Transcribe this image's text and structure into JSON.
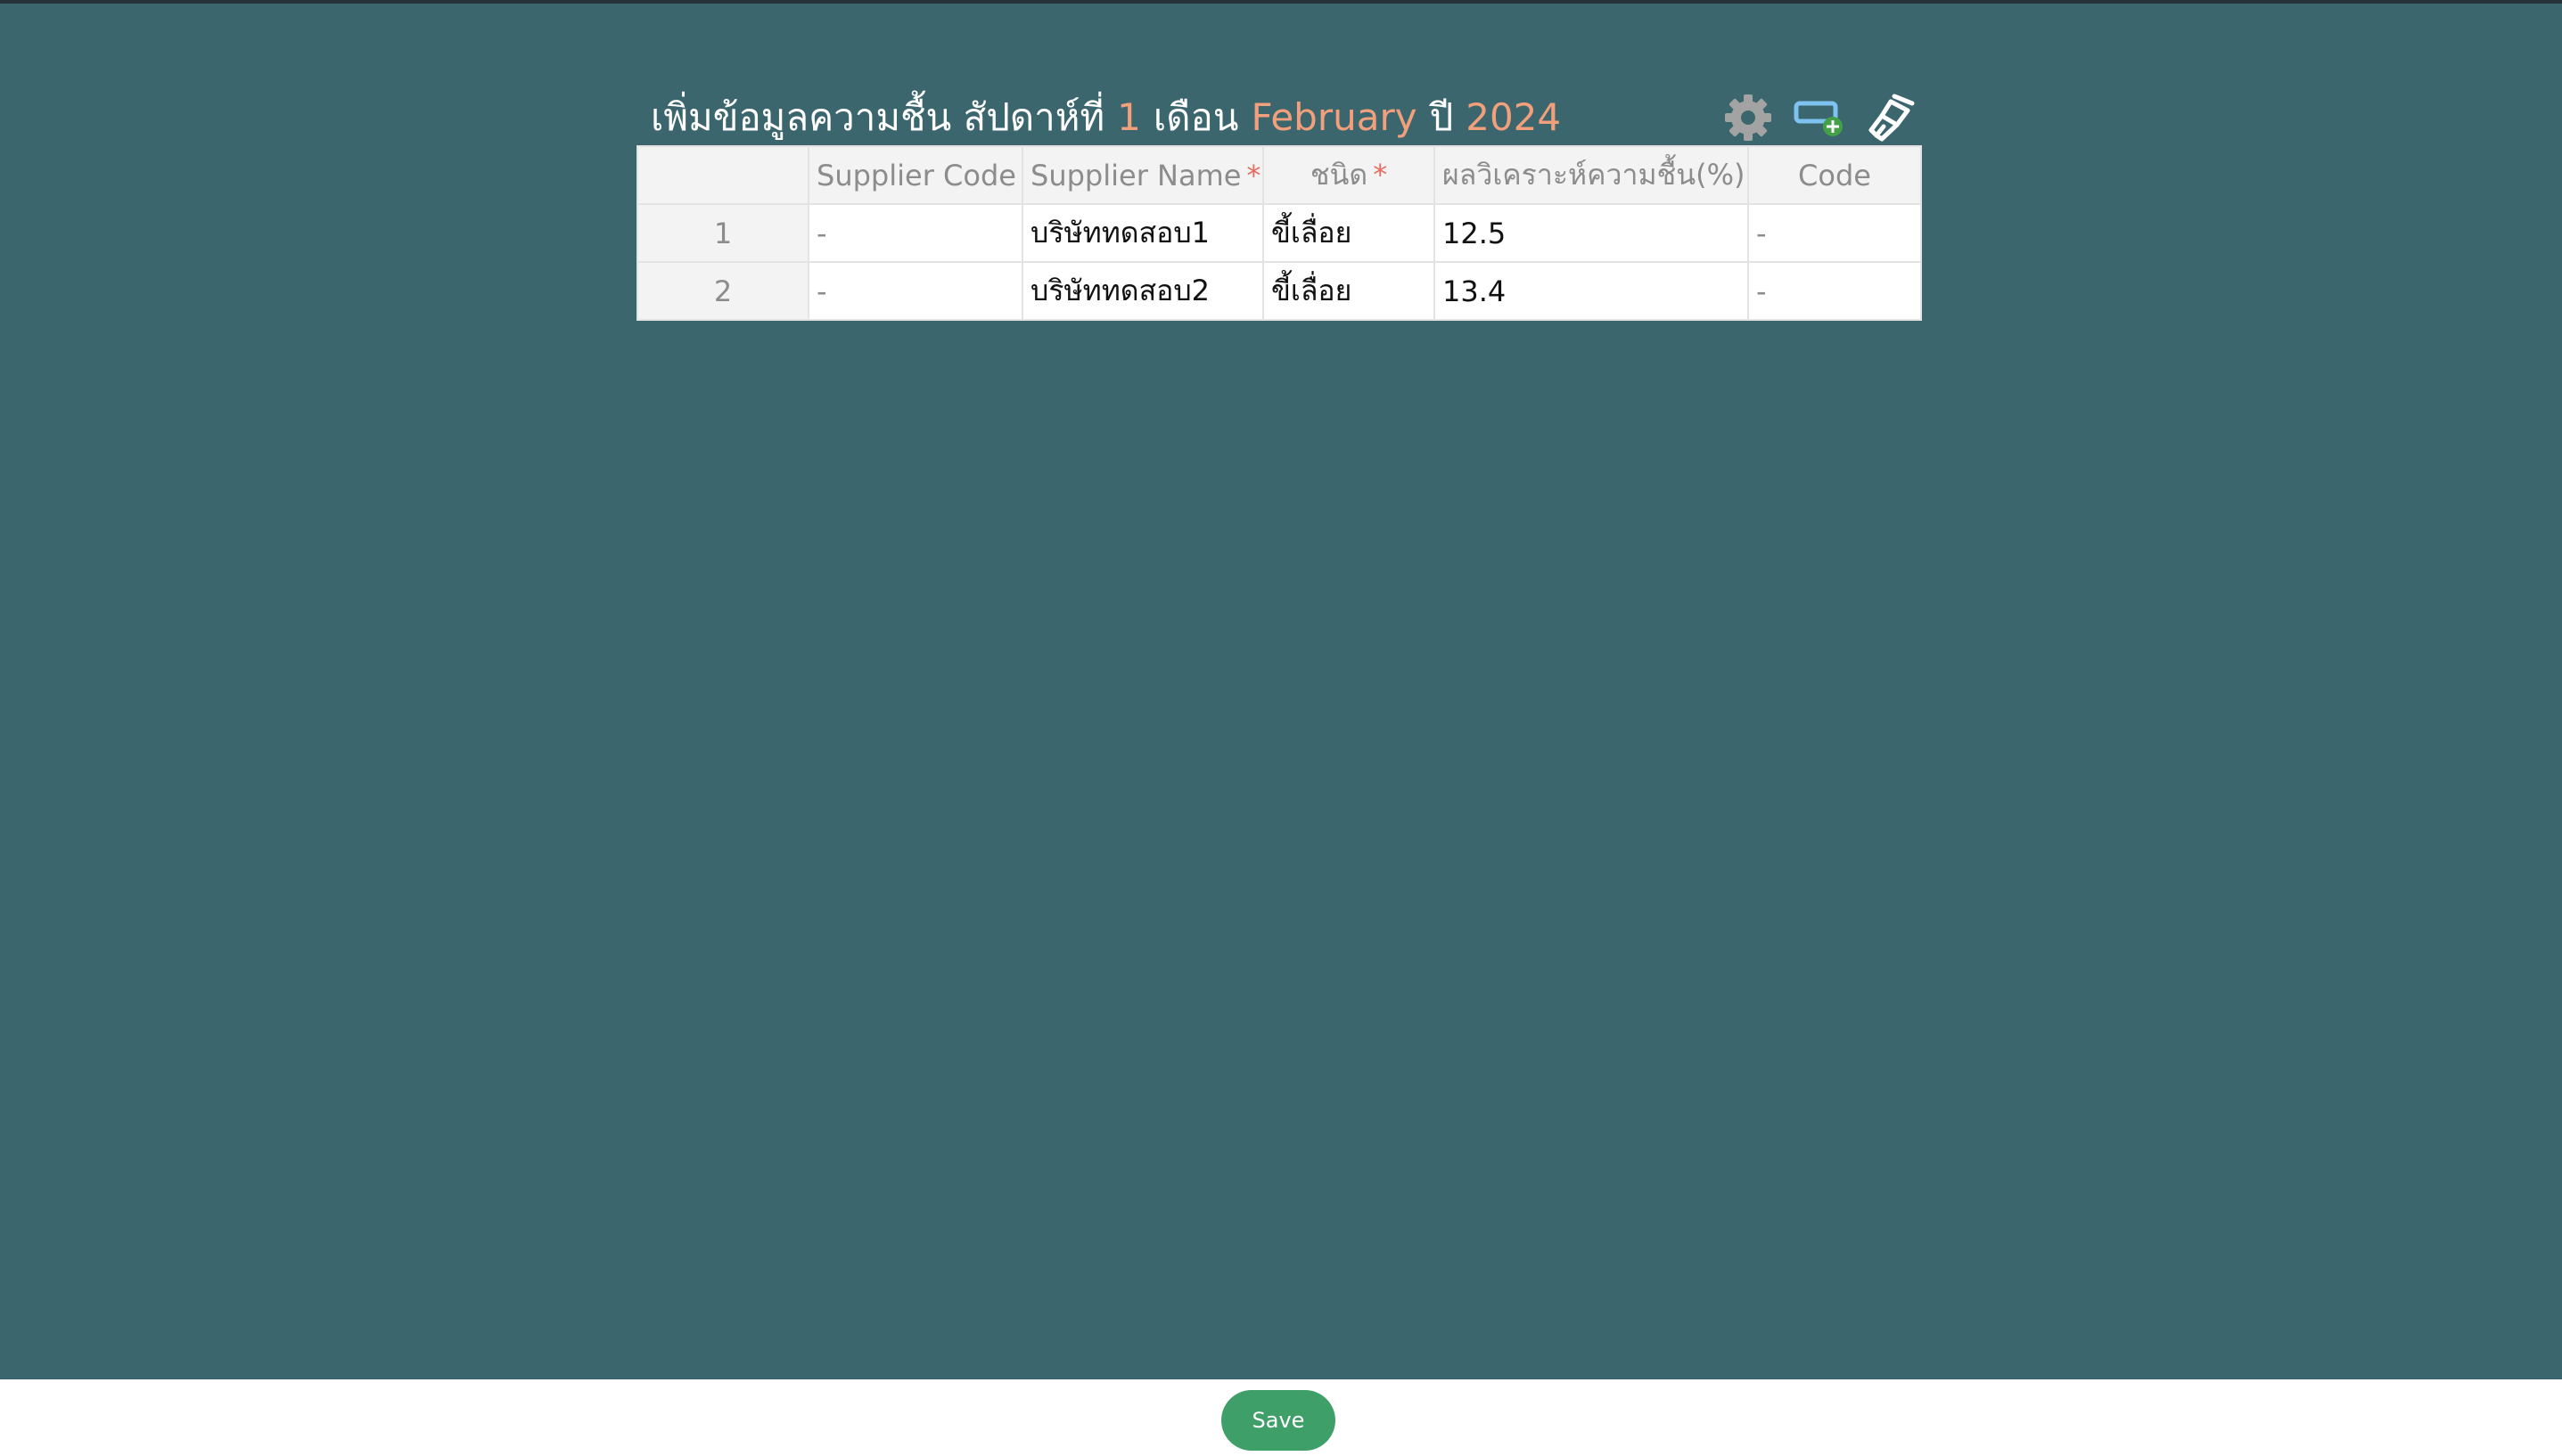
{
  "page": {
    "title_parts": {
      "prefix": "เพิ่มข้อมูลความชื้น สัปดาห์ที่",
      "week": "1",
      "month_label": "เดือน",
      "month": "February",
      "year_label": "ปี",
      "year": "2024"
    }
  },
  "toolbar": {
    "icons": [
      "gear-icon",
      "add-row-icon",
      "paintbrush-icon"
    ]
  },
  "table": {
    "columns": [
      {
        "label": "",
        "required": false
      },
      {
        "label": "Supplier Code",
        "required": false
      },
      {
        "label": "Supplier Name",
        "required": true
      },
      {
        "label": "ชนิด",
        "required": true
      },
      {
        "label": "ผลวิเคราะห์ความชื้น(%)",
        "required": true
      },
      {
        "label": "Code",
        "required": false
      }
    ],
    "required_mark": "*",
    "rows": [
      {
        "index": "1",
        "supplier_code": "-",
        "supplier_name": "บริษัททดสอบ1",
        "type": "ขี้เลื่อย",
        "moisture": "12.5",
        "code": "-"
      },
      {
        "index": "2",
        "supplier_code": "-",
        "supplier_name": "บริษัททดสอบ2",
        "type": "ขี้เลื่อย",
        "moisture": "13.4",
        "code": "-"
      }
    ]
  },
  "footer": {
    "save_label": "Save"
  },
  "colors": {
    "background": "#3b666d",
    "accent": "#f2a07b",
    "save_button": "#3f9f69",
    "required": "#e76b5e"
  }
}
